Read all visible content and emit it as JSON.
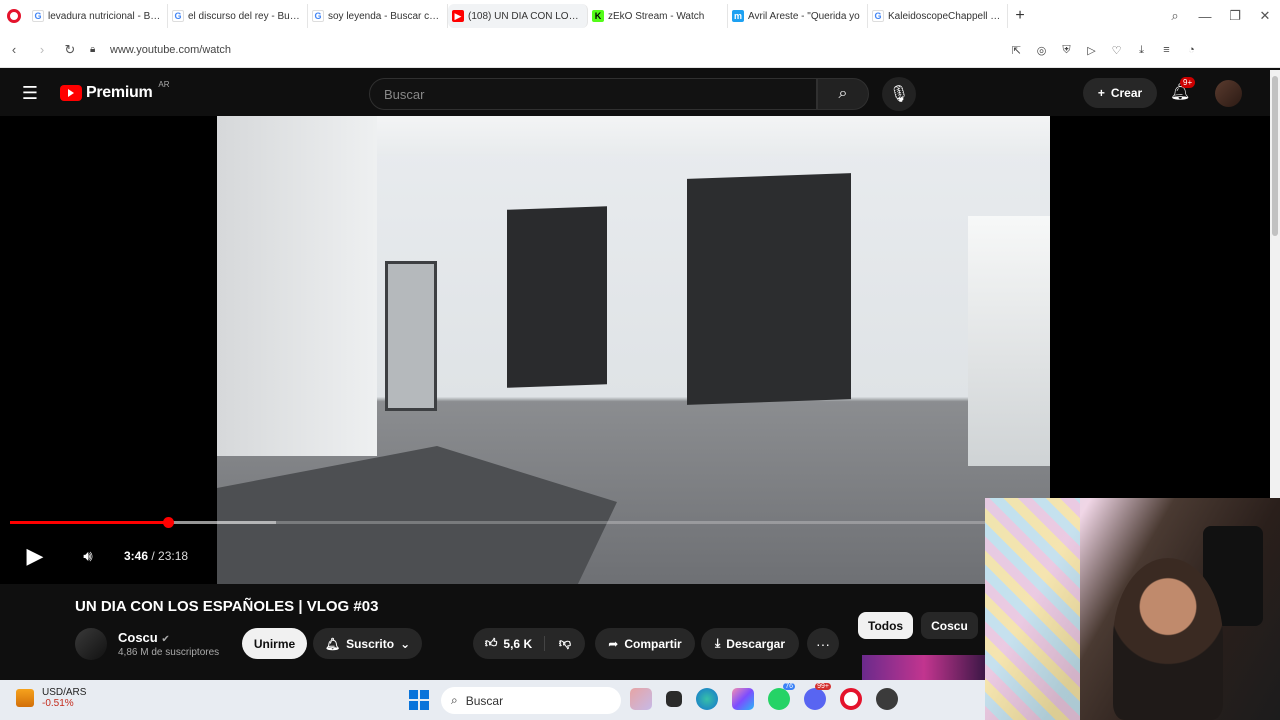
{
  "browser": {
    "tabs": [
      {
        "title": "levadura nutricional - Busc",
        "favicon_color": "#4285f4",
        "glyph": "G"
      },
      {
        "title": "el discurso del rey - Busca",
        "favicon_color": "#4285f4",
        "glyph": "G"
      },
      {
        "title": "soy leyenda - Buscar con G",
        "favicon_color": "#4285f4",
        "glyph": "G"
      },
      {
        "title": "(108) UN DIA CON LOS ES",
        "favicon_color": "#ff0000",
        "glyph": "▶",
        "active": true
      },
      {
        "title": "zEkO Stream - Watch",
        "favicon_color": "#53fc18",
        "glyph": "K"
      },
      {
        "title": "Avril Areste - \"Querida yo",
        "favicon_color": "#1da1f2",
        "glyph": "m"
      },
      {
        "title": "KaleidoscopeChappell Roa",
        "favicon_color": "#4285f4",
        "glyph": "G"
      }
    ],
    "url": "www.youtube.com/watch"
  },
  "youtube": {
    "brand": "Premium",
    "region": "AR",
    "search_placeholder": "Buscar",
    "create_label": "Crear",
    "notifications_badge": "9+"
  },
  "player": {
    "time_current": "3:46",
    "time_separator": " / ",
    "time_total": "23:18",
    "progress_fraction": 0.163
  },
  "video": {
    "title": "UN DIA CON LOS ESPAÑOLES | VLOG #03",
    "channel_name": "Coscu",
    "subscribers": "4,86 M de suscriptores",
    "join_label": "Unirme",
    "subscribed_label": "Suscrito",
    "likes": "5,6 K",
    "share_label": "Compartir",
    "download_label": "Descargar"
  },
  "chips": [
    "Todos",
    "Coscu"
  ],
  "taskbar": {
    "ticker_pair": "USD/ARS",
    "ticker_change": "-0.51%",
    "search_label": "Buscar",
    "whatsapp_badge": "76",
    "discord_badge": "99+"
  },
  "colors": {
    "accent": "#ff0000",
    "background": "#0f0f0f"
  }
}
